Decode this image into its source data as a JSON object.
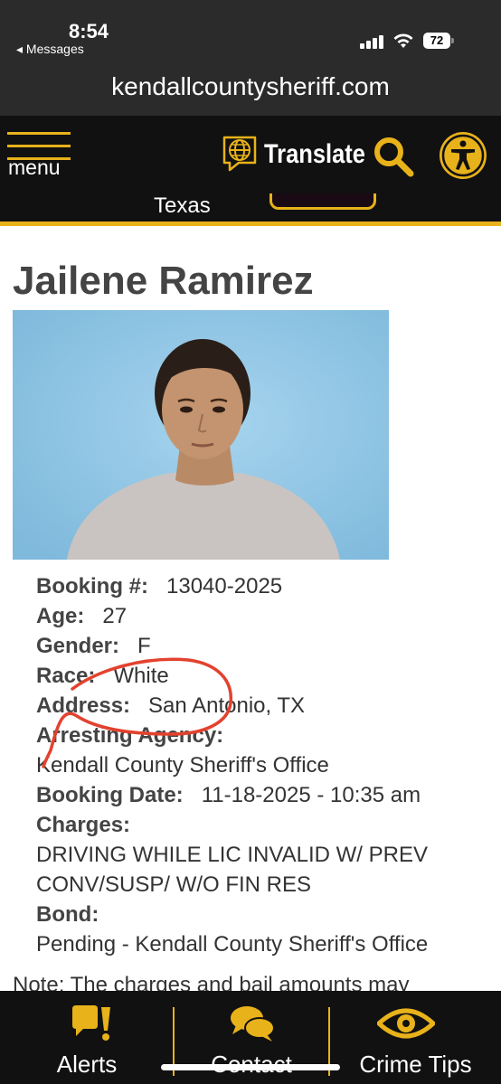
{
  "status_bar": {
    "time": "8:54",
    "back_app": "◂ Messages",
    "battery": "72"
  },
  "browser": {
    "url": "kendallcountysheriff.com"
  },
  "nav": {
    "menu_label": "menu",
    "translate_label": "Translate",
    "accent_color": "#e8b21a"
  },
  "subheader": {
    "location_text": "Texas"
  },
  "inmate": {
    "name": "Jailene Ramirez",
    "booking_number_label": "Booking #:",
    "booking_number": "13040-2025",
    "age_label": "Age:",
    "age": "27",
    "gender_label": "Gender:",
    "gender": "F",
    "race_label": "Race:",
    "race": "White",
    "address_label": "Address:",
    "address": "San Antonio, TX",
    "arresting_agency_label": "Arresting Agency:",
    "arresting_agency": "Kendall County Sheriff's Office",
    "booking_date_label": "Booking Date:",
    "booking_date": "11-18-2025 - 10:35 am",
    "charges_label": "Charges:",
    "charges_line1": "DRIVING WHILE LIC INVALID W/ PREV",
    "charges_line2": "CONV/SUSP/ W/O FIN RES",
    "bond_label": "Bond:",
    "bond": "Pending - Kendall County Sheriff's Office"
  },
  "note": "Note: The charges and bail amounts may",
  "bottom_nav": {
    "items": [
      {
        "label": "Alerts",
        "icon": "alert-bubble-icon"
      },
      {
        "label": "Contact",
        "icon": "chat-bubbles-icon"
      },
      {
        "label": "Crime Tips",
        "icon": "eye-icon"
      }
    ]
  }
}
